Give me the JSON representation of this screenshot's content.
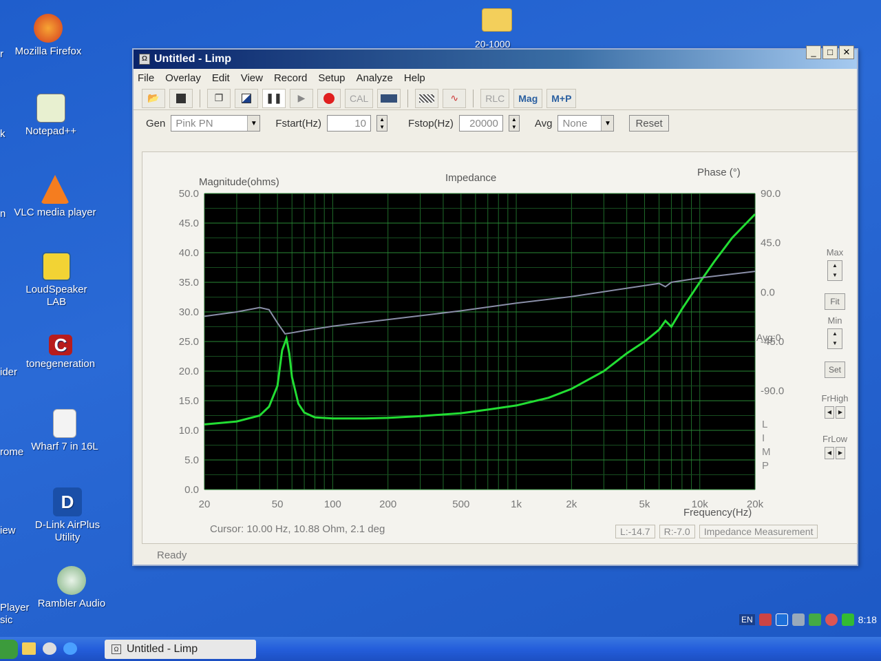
{
  "desktop": {
    "icons": [
      {
        "label": "Mozilla Firefox"
      },
      {
        "label": "Notepad++"
      },
      {
        "label": "VLC media player"
      },
      {
        "label": "LoudSpeaker LAB"
      },
      {
        "label": "tonegeneration"
      },
      {
        "label": "Wharf 7 in 16L"
      },
      {
        "label": "D-Link AirPlus Utility"
      },
      {
        "label": "Rambler Audio"
      }
    ],
    "edge_labels": [
      "r",
      "k",
      "n",
      "ider",
      "rome",
      "iew",
      "Player",
      "sic"
    ],
    "folder_label": "20-1000"
  },
  "window": {
    "title": "Untitled - Limp",
    "controls": {
      "minimize": "_",
      "maximize": "□",
      "close": "✕"
    },
    "menu": [
      "File",
      "Overlay",
      "Edit",
      "View",
      "Record",
      "Setup",
      "Analyze",
      "Help"
    ],
    "toolbar": {
      "cal": "CAL",
      "rlc": "RLC",
      "mag": "Mag",
      "mp": "M+P"
    },
    "params": {
      "gen_label": "Gen",
      "gen_value": "Pink PN",
      "fstart_label": "Fstart(Hz)",
      "fstart_value": "10",
      "fstop_label": "Fstop(Hz)",
      "fstop_value": "20000",
      "avg_label": "Avg",
      "avg_value": "None",
      "reset_label": "Reset"
    },
    "side_panel": {
      "max_label": "Max",
      "fit_label": "Fit",
      "min_label": "Min",
      "set_label": "Set",
      "frhigh_label": "FrHigh",
      "frlow_label": "FrLow"
    },
    "cursor_text": "Cursor: 10.00 Hz, 10.88 Ohm, 2.1 deg",
    "status": {
      "l_value": "L:-14.7",
      "r_value": "R:-7.0",
      "mode": "Impedance Measurement"
    },
    "ready": "Ready"
  },
  "chart_data": {
    "type": "line",
    "title": "Impedance",
    "ylabel": "Magnitude(ohms)",
    "y2label": "Phase (°)",
    "xlabel": "Frequency(Hz)",
    "x_scale": "log",
    "xlim": [
      20,
      20000
    ],
    "ylim": [
      0,
      50
    ],
    "y2lim": [
      -180,
      90
    ],
    "x_ticks": [
      "20",
      "50",
      "100",
      "200",
      "500",
      "1k",
      "2k",
      "5k",
      "10k",
      "20k"
    ],
    "y_ticks": [
      "0.0",
      "5.0",
      "10.0",
      "15.0",
      "20.0",
      "25.0",
      "30.0",
      "35.0",
      "40.0",
      "45.0",
      "50.0"
    ],
    "y2_ticks": [
      "90.0",
      "45.0",
      "0.0",
      "-45.0",
      "-90.0"
    ],
    "y2_extra_label": "Avg:0",
    "side_text": [
      "L",
      "I",
      "M",
      "P"
    ],
    "grid": true,
    "background": "#000000",
    "series": [
      {
        "name": "Magnitude",
        "color": "#22dd33",
        "x": [
          20,
          30,
          40,
          45,
          50,
          53,
          56,
          58,
          60,
          65,
          70,
          80,
          100,
          150,
          200,
          300,
          500,
          700,
          1000,
          1500,
          2000,
          3000,
          4000,
          5000,
          6000,
          6500,
          7000,
          8000,
          10000,
          12000,
          15000,
          20000
        ],
        "y": [
          11.0,
          11.5,
          12.5,
          14.0,
          17.5,
          23.5,
          25.5,
          23.0,
          19.0,
          14.5,
          13.0,
          12.2,
          12.0,
          12.0,
          12.1,
          12.4,
          12.9,
          13.5,
          14.2,
          15.5,
          17.0,
          20.0,
          23.0,
          25.0,
          27.0,
          28.5,
          27.5,
          30.5,
          35.0,
          38.5,
          42.5,
          46.5
        ]
      },
      {
        "name": "Phase",
        "color": "#8a8fa8",
        "x": [
          20,
          30,
          40,
          45,
          50,
          55,
          60,
          70,
          100,
          200,
          500,
          1000,
          2000,
          5000,
          6000,
          6500,
          7000,
          10000,
          20000
        ],
        "y": [
          -22,
          -18,
          -14,
          -16,
          -28,
          -38,
          -37,
          -35,
          -31,
          -25,
          -17,
          -10,
          -4,
          6,
          8,
          5,
          9,
          13,
          19
        ]
      }
    ]
  },
  "taskbar": {
    "task_label": "Untitled - Limp",
    "lang": "EN",
    "time": "8:18"
  }
}
